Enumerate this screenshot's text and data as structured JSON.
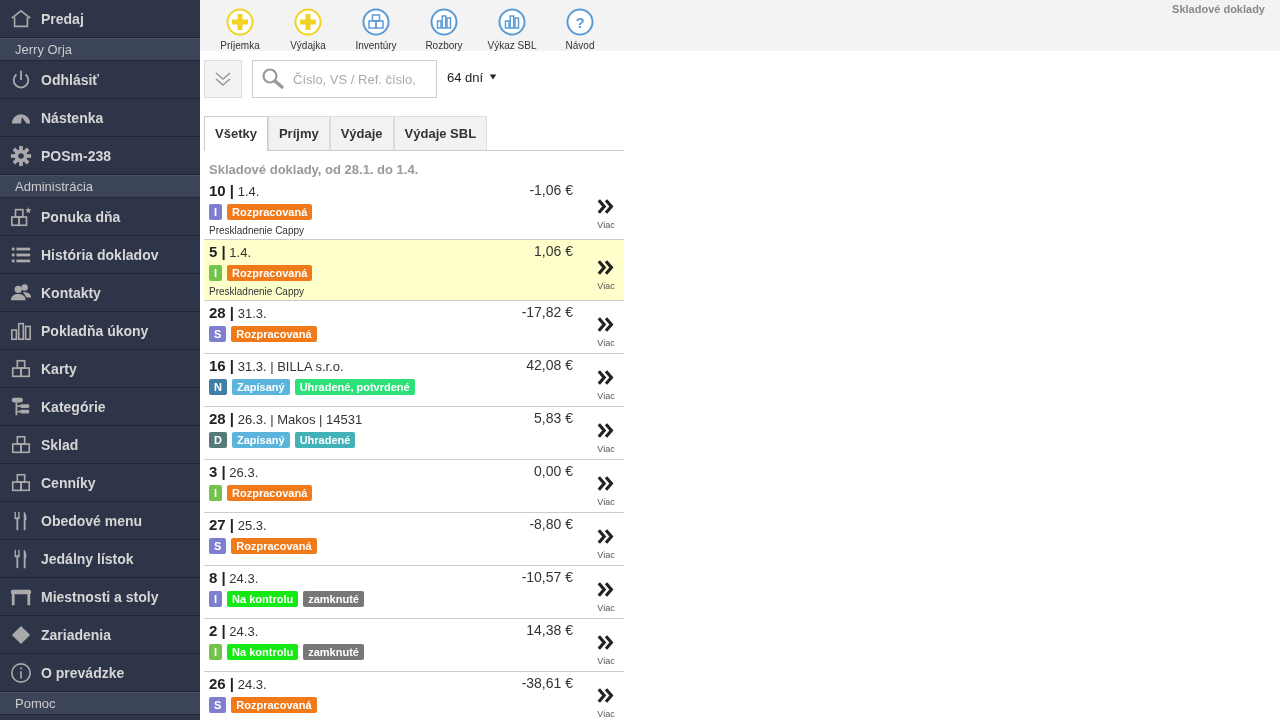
{
  "sidebar": {
    "items": [
      {
        "kind": "item",
        "label": "Predaj"
      },
      {
        "kind": "header",
        "label": "Jerry Orja"
      },
      {
        "kind": "item",
        "label": "Odhlásiť"
      },
      {
        "kind": "item",
        "label": "Nástenka"
      },
      {
        "kind": "item",
        "label": "POSm-238"
      },
      {
        "kind": "header",
        "label": "Administrácia"
      },
      {
        "kind": "item",
        "label": "Ponuka dňa"
      },
      {
        "kind": "item",
        "label": "História dokladov"
      },
      {
        "kind": "item",
        "label": "Kontakty"
      },
      {
        "kind": "item",
        "label": "Pokladňa úkony"
      },
      {
        "kind": "item",
        "label": "Karty"
      },
      {
        "kind": "item",
        "label": "Kategórie"
      },
      {
        "kind": "item",
        "label": "Sklad"
      },
      {
        "kind": "item",
        "label": "Cenníky"
      },
      {
        "kind": "item",
        "label": "Obedové menu"
      },
      {
        "kind": "item",
        "label": "Jedálny lístok"
      },
      {
        "kind": "item",
        "label": "Miestnosti a stoly"
      },
      {
        "kind": "item",
        "label": "Zariadenia"
      },
      {
        "kind": "item",
        "label": "O prevádzke"
      },
      {
        "kind": "header",
        "label": "Pomoc"
      }
    ]
  },
  "toolbar": [
    {
      "label": "Príjemka",
      "color": "#f2d324"
    },
    {
      "label": "Výdajka",
      "color": "#f2d324"
    },
    {
      "label": "Inventúry",
      "color": "#5b9bd5"
    },
    {
      "label": "Rozbory",
      "color": "#5b9bd5"
    },
    {
      "label": "Výkaz SBL",
      "color": "#5b9bd5"
    },
    {
      "label": "Návod",
      "color": "#5b9bd5",
      "symbol": "?"
    }
  ],
  "page_title": "Skladové doklady",
  "search": {
    "placeholder": "Číslo, VS / Ref. číslo,"
  },
  "period": "64 dní",
  "tabs": [
    {
      "label": "Všetky",
      "selected": true
    },
    {
      "label": "Príjmy",
      "selected": false
    },
    {
      "label": "Výdaje",
      "selected": false
    },
    {
      "label": "Výdaje SBL",
      "selected": false
    }
  ],
  "list_title": "Skladové doklady, od 28.1. do 1.4.",
  "rows": [
    {
      "heading": "**10 |** 1.4.",
      "amount": "-1,06 €",
      "type": {
        "letter": "I",
        "color": "#7f7fd0"
      },
      "badges": [
        {
          "text": "Rozpracovaná",
          "color": "#f07a1a"
        }
      ],
      "note": "Preskladnenie Cappy",
      "more": "Viac",
      "selected": false
    },
    {
      "heading": "**5 |** 1.4.",
      "amount": "1,06 €",
      "type": {
        "letter": "I",
        "color": "#72c44a"
      },
      "badges": [
        {
          "text": "Rozpracovaná",
          "color": "#f07a1a"
        }
      ],
      "note": "Preskladnenie Cappy",
      "more": "Viac",
      "selected": true
    },
    {
      "heading": "**28 |** 31.3.",
      "amount": "-17,82 €",
      "type": {
        "letter": "S",
        "color": "#7f7fd0"
      },
      "badges": [
        {
          "text": "Rozpracovaná",
          "color": "#f07a1a"
        }
      ],
      "more": "Viac",
      "selected": false
    },
    {
      "heading": "**16 |** 31.3. | BILLA s.r.o.",
      "amount": "42,08 €",
      "type": {
        "letter": "N",
        "color": "#3f7fa6"
      },
      "badges": [
        {
          "text": "Zapísaný",
          "color": "#5ab4dc"
        },
        {
          "text": "Uhradené, potvrdené",
          "color": "#2ee07a"
        }
      ],
      "more": "Viac",
      "selected": false
    },
    {
      "heading": "**28 |** 26.3. | Makos | 14531",
      "amount": "5,83 €",
      "type": {
        "letter": "D",
        "color": "#557a78"
      },
      "badges": [
        {
          "text": "Zapísaný",
          "color": "#5ab4dc"
        },
        {
          "text": "Uhradené",
          "color": "#42b2b8"
        }
      ],
      "more": "Viac",
      "selected": false
    },
    {
      "heading": "**3 |** 26.3.",
      "amount": "0,00 €",
      "type": {
        "letter": "I",
        "color": "#72c44a"
      },
      "badges": [
        {
          "text": "Rozpracovaná",
          "color": "#f07a1a"
        }
      ],
      "more": "Viac",
      "selected": false
    },
    {
      "heading": "**27 |** 25.3.",
      "amount": "-8,80 €",
      "type": {
        "letter": "S",
        "color": "#7f7fd0"
      },
      "badges": [
        {
          "text": "Rozpracovaná",
          "color": "#f07a1a"
        }
      ],
      "more": "Viac",
      "selected": false
    },
    {
      "heading": "**8 |** 24.3.",
      "amount": "-10,57 €",
      "type": {
        "letter": "I",
        "color": "#7f7fd0"
      },
      "badges": [
        {
          "text": "Na kontrolu",
          "color": "#16e816"
        },
        {
          "text": "zamknuté",
          "color": "#777777"
        }
      ],
      "more": "Viac",
      "selected": false
    },
    {
      "heading": "**2 |** 24.3.",
      "amount": "14,38 €",
      "type": {
        "letter": "I",
        "color": "#72c44a"
      },
      "badges": [
        {
          "text": "Na kontrolu",
          "color": "#16e816"
        },
        {
          "text": "zamknuté",
          "color": "#777777"
        }
      ],
      "more": "Viac",
      "selected": false
    },
    {
      "heading": "**26 |** 24.3.",
      "amount": "-38,61 €",
      "type": {
        "letter": "S",
        "color": "#7f7fd0"
      },
      "badges": [
        {
          "text": "Rozpracovaná",
          "color": "#f07a1a"
        }
      ],
      "more": "Viac",
      "selected": false
    }
  ]
}
